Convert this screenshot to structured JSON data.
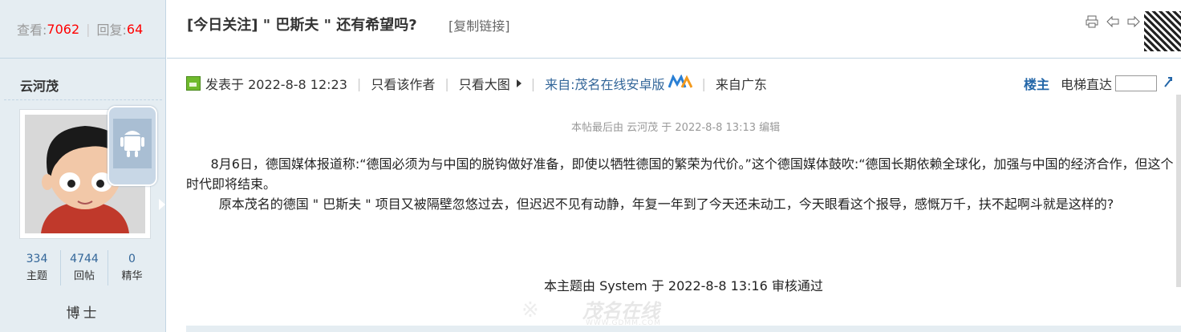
{
  "stats_top": {
    "views_label": "查看:",
    "views": "7062",
    "replies_label": "回复:",
    "replies": "64"
  },
  "thread": {
    "title": "[今日关注]  \" 巴斯夫 \" 还有希望吗?",
    "copy_link": "[复制链接]"
  },
  "author": {
    "name": "云河茂",
    "stats": [
      {
        "value": "334",
        "label": "主题"
      },
      {
        "value": "4744",
        "label": "回帖"
      },
      {
        "value": "0",
        "label": "精华"
      }
    ],
    "rank": "博士"
  },
  "post_meta": {
    "posted": "发表于 2022-8-8 12:23",
    "only_author": "只看该作者",
    "large_image": "只看大图",
    "from_app": "来自:茂名在线安卓版",
    "location": "来自广东"
  },
  "floor": {
    "main": "楼主",
    "elevator": "电梯直达"
  },
  "edit_note": "本帖最后由 云河茂 于 2022-8-8 13:13 编辑",
  "content": {
    "para1": "      8月6日，德国媒体报道称:“德国必须为与中国的脱钩做好准备，即使以牺牲德国的繁荣为代价。”这个德国媒体鼓吹:“德国长期依赖全球化，加强与中国的经济合作，但这个时代即将结束。",
    "para2": "        原本茂名的德国 \" 巴斯夫 \" 项目又被隔壁忽悠过去，但迟迟不见有动静，年复一年到了今天还未动工，今天眼看这个报导，感慨万千，扶不起啊斗就是这样的?"
  },
  "audit": "本主题由 System 于 2022-8-8 13:16 审核通过",
  "watermark": {
    "cn": "茂名在线",
    "en": "WWW.GDMM.COM"
  },
  "icons": [
    "print-icon",
    "prev-thread-icon",
    "next-thread-icon",
    "post-icon",
    "triangle-right-icon",
    "android-icon",
    "go-icon"
  ],
  "colors": {
    "count_red": "#ff0000",
    "link_blue": "#336699",
    "sidebar_bg": "#e5edf2"
  }
}
